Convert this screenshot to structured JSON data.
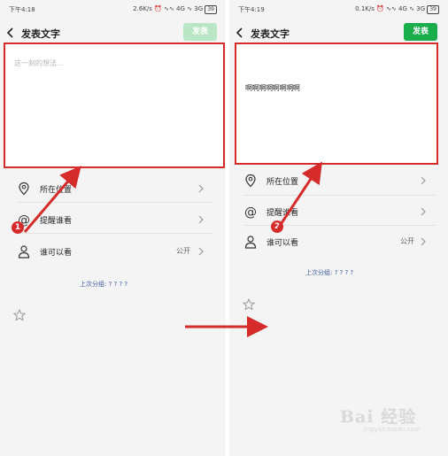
{
  "left": {
    "status": {
      "time": "下午4:18",
      "network": "2.6K/s",
      "signal": "4G",
      "signal2": "3G",
      "battery": "39"
    },
    "header": {
      "title": "发表文字",
      "post_label": "发表"
    },
    "composer": {
      "placeholder": "这一刻的想法...",
      "value": ""
    },
    "options": [
      {
        "label": "所在位置",
        "value": "",
        "icon": "location-pin-icon"
      },
      {
        "label": "提醒谁看",
        "value": "",
        "icon": "at-mention-icon"
      },
      {
        "label": "谁可以看",
        "value": "公开",
        "icon": "person-icon"
      }
    ],
    "last_group": "上次分组: ? ? ? ?",
    "step": "1"
  },
  "right": {
    "status": {
      "time": "下午4:19",
      "network": "0.1K/s",
      "signal": "4G",
      "signal2": "3G",
      "battery": "39"
    },
    "header": {
      "title": "发表文字",
      "post_label": "发表"
    },
    "composer": {
      "placeholder": "",
      "value": "啊啊啊啊啊啊啊啊"
    },
    "options": [
      {
        "label": "所在位置",
        "value": "",
        "icon": "location-pin-icon"
      },
      {
        "label": "提醒谁看",
        "value": "",
        "icon": "at-mention-icon"
      },
      {
        "label": "谁可以看",
        "value": "公开",
        "icon": "person-icon"
      }
    ],
    "last_group": "上次分组: ? ? ? ?",
    "step": "2"
  },
  "colors": {
    "accent_green": "#1aad4c",
    "accent_green_disabled": "#b9e6c4",
    "annotation_red": "#d62b2b",
    "link_blue": "#3a5aa0"
  },
  "watermark": {
    "logo": "Bai 经验",
    "url": "jingyan.baidu.com"
  }
}
